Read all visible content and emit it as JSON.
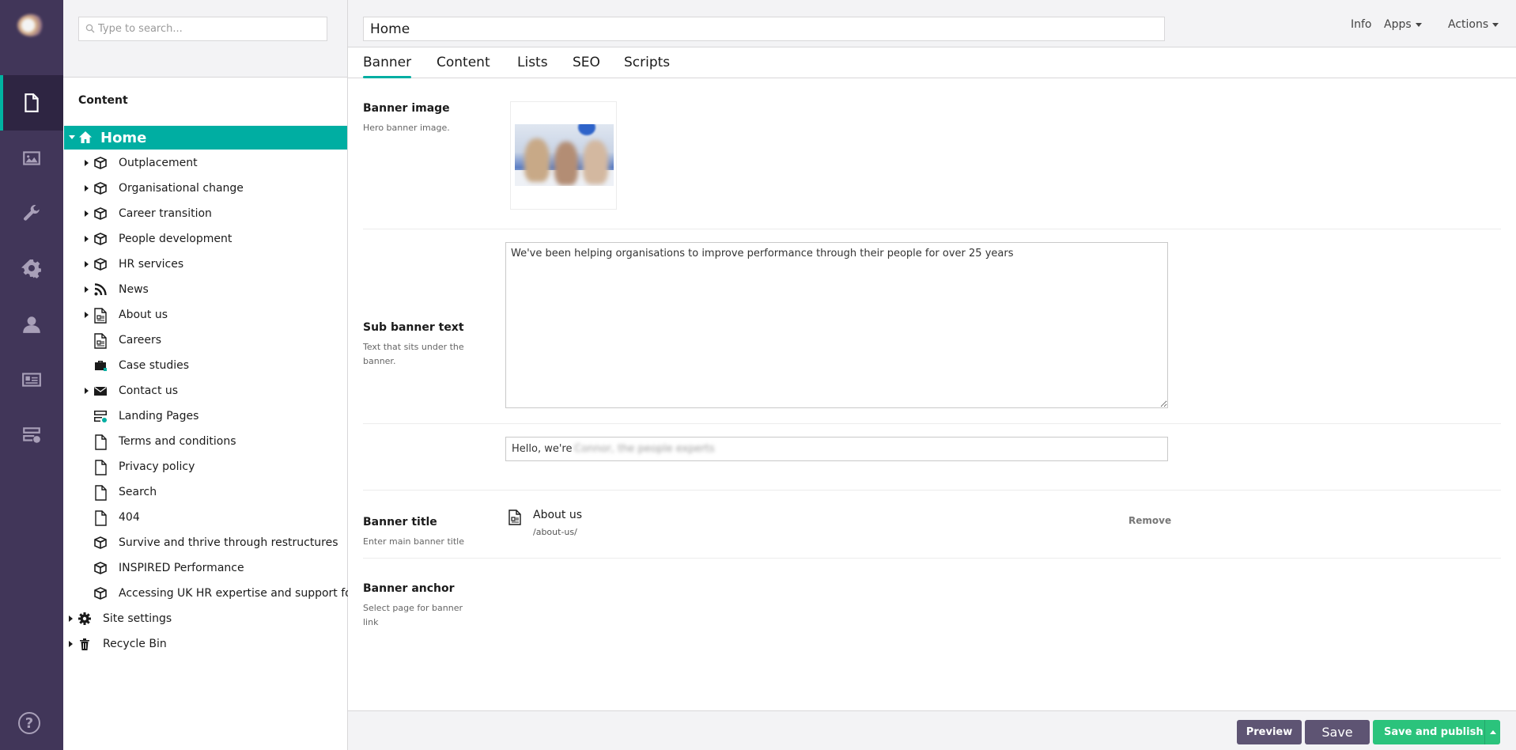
{
  "app_nav": {
    "sections": [
      {
        "name": "content",
        "icon": "document-icon",
        "active": true
      },
      {
        "name": "media",
        "icon": "image-icon",
        "active": false
      },
      {
        "name": "settings",
        "icon": "wrench-icon",
        "active": false
      },
      {
        "name": "packages",
        "icon": "gear-icon",
        "active": false
      },
      {
        "name": "users",
        "icon": "user-icon",
        "active": false
      },
      {
        "name": "members",
        "icon": "id-card-icon",
        "active": false
      },
      {
        "name": "forms",
        "icon": "server-icon",
        "active": false
      }
    ],
    "help": "?"
  },
  "tree": {
    "search_placeholder": "Type to search...",
    "root_label": "Content",
    "home_label": "Home",
    "items": [
      {
        "label": "Outplacement",
        "icon": "box-icon",
        "expandable": true
      },
      {
        "label": "Organisational change",
        "icon": "box-icon",
        "expandable": true
      },
      {
        "label": "Career transition",
        "icon": "box-icon",
        "expandable": true
      },
      {
        "label": "People development",
        "icon": "box-icon",
        "expandable": true
      },
      {
        "label": "HR services",
        "icon": "box-icon",
        "expandable": true
      },
      {
        "label": "News",
        "icon": "rss-icon",
        "expandable": true
      },
      {
        "label": "About us",
        "icon": "document-info-icon",
        "expandable": true
      },
      {
        "label": "Careers",
        "icon": "document-info-icon",
        "expandable": false
      },
      {
        "label": "Case studies",
        "icon": "briefcase-icon",
        "expandable": false
      },
      {
        "label": "Contact us",
        "icon": "envelope-icon",
        "expandable": true
      },
      {
        "label": "Landing Pages",
        "icon": "server-icon",
        "expandable": false
      },
      {
        "label": "Terms and conditions",
        "icon": "page-icon",
        "expandable": false
      },
      {
        "label": "Privacy policy",
        "icon": "page-icon",
        "expandable": false
      },
      {
        "label": "Search",
        "icon": "page-icon",
        "expandable": false
      },
      {
        "label": "404",
        "icon": "page-icon",
        "expandable": false
      },
      {
        "label": "Survive and thrive through restructures",
        "icon": "box-icon",
        "expandable": false
      },
      {
        "label": "INSPIRED Performance",
        "icon": "box-icon",
        "expandable": false
      },
      {
        "label": "Accessing UK HR expertise and support for",
        "icon": "box-icon",
        "expandable": false
      }
    ],
    "root_items": [
      {
        "label": "Site settings",
        "icon": "gear-icon"
      },
      {
        "label": "Recycle Bin",
        "icon": "trash-icon"
      }
    ]
  },
  "header": {
    "node_name": "Home",
    "info": "Info",
    "apps": "Apps",
    "actions": "Actions"
  },
  "tabs": [
    {
      "label": "Banner",
      "active": true
    },
    {
      "label": "Content",
      "active": false
    },
    {
      "label": "Lists",
      "active": false
    },
    {
      "label": "SEO",
      "active": false
    },
    {
      "label": "Scripts",
      "active": false
    }
  ],
  "properties": {
    "banner_image": {
      "label": "Banner image",
      "description": "Hero banner image."
    },
    "sub_banner_text": {
      "label": "Sub banner text",
      "description": "Text that sits under the banner.",
      "value": "We've been helping organisations to improve performance through their people for over 25 years"
    },
    "banner_title": {
      "label": "Banner title",
      "description": "Enter main banner title",
      "value_prefix": "Hello, we're",
      "value_redacted": "Connor, the people experts"
    },
    "banner_anchor": {
      "label": "Banner anchor",
      "description": "Select page for banner link",
      "link_name": "About us",
      "link_url": "/about-us/",
      "remove": "Remove"
    }
  },
  "footer": {
    "preview": "Preview",
    "save": "Save",
    "save_and_publish": "Save and publish"
  },
  "colors": {
    "sidebar": "#413659",
    "accent": "#00aea2",
    "publish": "#2bc37c",
    "secondary_button": "#5e5473"
  }
}
